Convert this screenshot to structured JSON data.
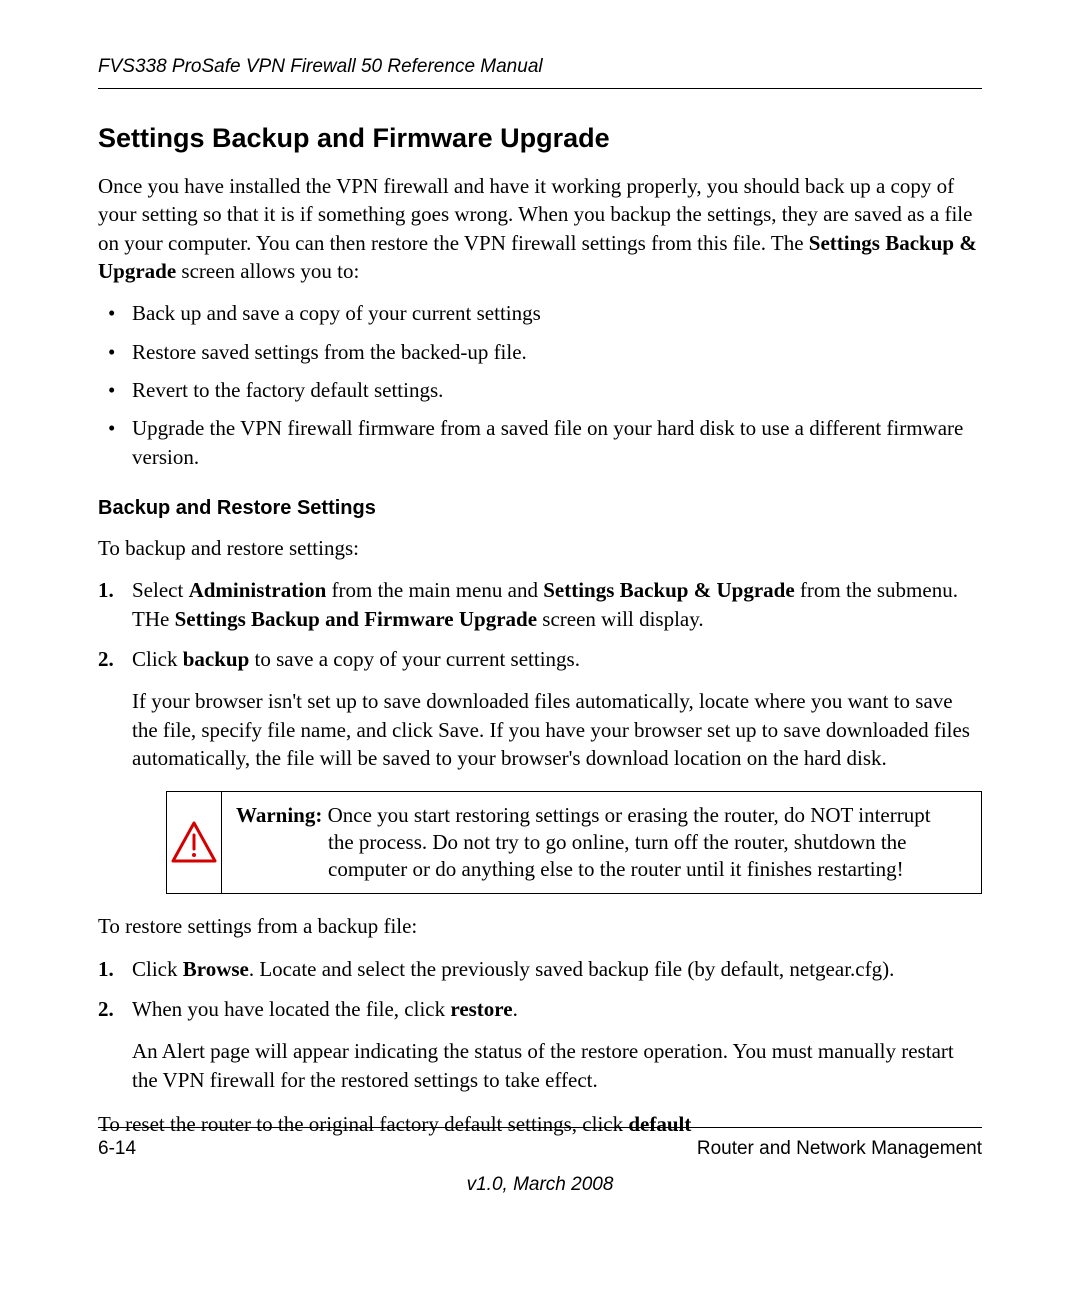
{
  "header": {
    "running": "FVS338 ProSafe VPN Firewall 50 Reference Manual"
  },
  "title": "Settings Backup and Firmware Upgrade",
  "intro": {
    "text_before_bold": "Once you have installed the VPN firewall and have it working properly, you should back up a copy of your setting so that it is if something goes wrong. When you backup the settings, they are saved as a file on your computer. You can then restore the VPN firewall settings from this file. The ",
    "bold": "Settings Backup & Upgrade",
    "text_after_bold": " screen allows you to:"
  },
  "bullets": [
    "Back up and save a copy of your current settings",
    "Restore saved settings from the backed-up file.",
    "Revert to the factory default settings.",
    "Upgrade the VPN firewall firmware from a saved file on your hard disk to use a different firmware version."
  ],
  "subhead": "Backup and Restore Settings",
  "backup_intro": "To backup and restore settings:",
  "step1": {
    "t1": "Select ",
    "b1": "Administration",
    "t2": " from the main menu and ",
    "b2": "Settings Backup & Upgrade",
    "t3": " from the submenu. THe ",
    "b3": "Settings Backup and Firmware Upgrade",
    "t4": " screen will display."
  },
  "step2": {
    "t1": "Click ",
    "b1": "backup",
    "t2": " to save a copy of your current settings.",
    "para": "If your browser isn't set up to save downloaded files automatically, locate where you want to save the file, specify file name, and click Save. If you have your browser set up to save downloaded files automatically, the file will be saved to your browser's download location on the hard disk."
  },
  "warning": {
    "label": "Warning:",
    "line1": " Once you start restoring settings or erasing the router, do NOT interrupt ",
    "rest": "the process. Do not try to go online, turn off the router, shutdown the computer or do anything else to the router until it finishes restarting!"
  },
  "restore_intro": "To restore settings from a backup file:",
  "rstep1": {
    "t1": "Click ",
    "b1": "Browse",
    "t2": ". Locate and select the previously saved backup file (by default, netgear.cfg)."
  },
  "rstep2": {
    "t1": "When you have located the file, click ",
    "b1": "restore",
    "t2": ".",
    "para": "An Alert page will appear indicating the status of the restore operation. You must manually restart the VPN firewall for the restored settings to take effect."
  },
  "reset": {
    "t1": "To reset the router to the original factory default settings, click ",
    "b1": "default"
  },
  "footer": {
    "page": "6-14",
    "chapter": "Router and Network Management",
    "version": "v1.0, March 2008"
  }
}
